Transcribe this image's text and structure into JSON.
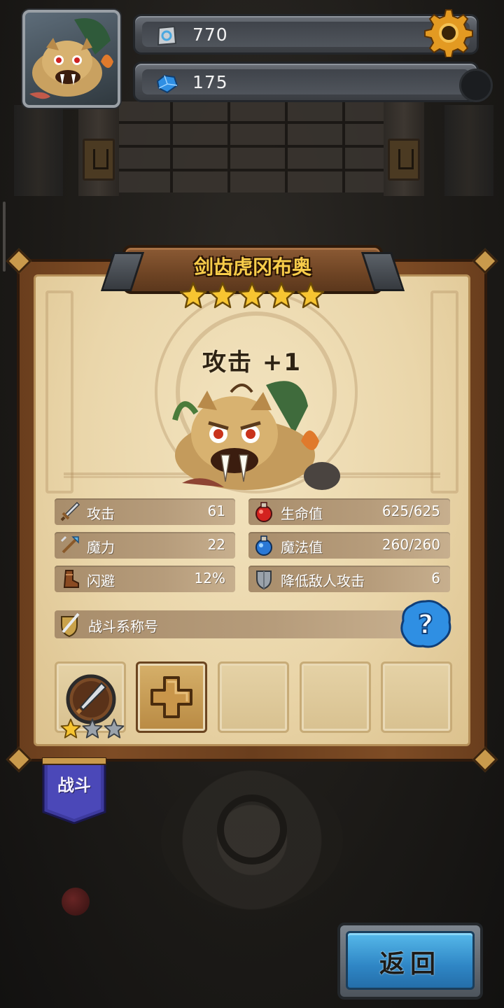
{
  "resources": {
    "stone_value": "770",
    "gem_value": "175"
  },
  "monster": {
    "name": "剑齿虎冈布奥",
    "star_count": 5,
    "buff_text": "攻击 +1"
  },
  "stats": {
    "attack": {
      "label": "攻击",
      "value": "61",
      "icon": "sword-icon"
    },
    "hp": {
      "label": "生命值",
      "value": "625/625",
      "icon": "red-potion-icon"
    },
    "magic": {
      "label": "魔力",
      "value": "22",
      "icon": "magic-staff-icon"
    },
    "mp": {
      "label": "魔法值",
      "value": "260/260",
      "icon": "blue-potion-icon"
    },
    "dodge": {
      "label": "闪避",
      "value": "12%",
      "icon": "boot-icon"
    },
    "defense": {
      "label": "降低敌人攻击",
      "value": "6",
      "icon": "shield-icon"
    }
  },
  "title_bar": {
    "label": "战斗系称号"
  },
  "skill_slot": {
    "stars_filled": 1,
    "stars_total": 3
  },
  "tabs": {
    "battle_label": "战斗"
  },
  "buttons": {
    "back_label": "返回"
  },
  "colors": {
    "accent_gold": "#f7cc4a",
    "button_blue": "#2f86c5",
    "parchment": "#ead6aa"
  }
}
